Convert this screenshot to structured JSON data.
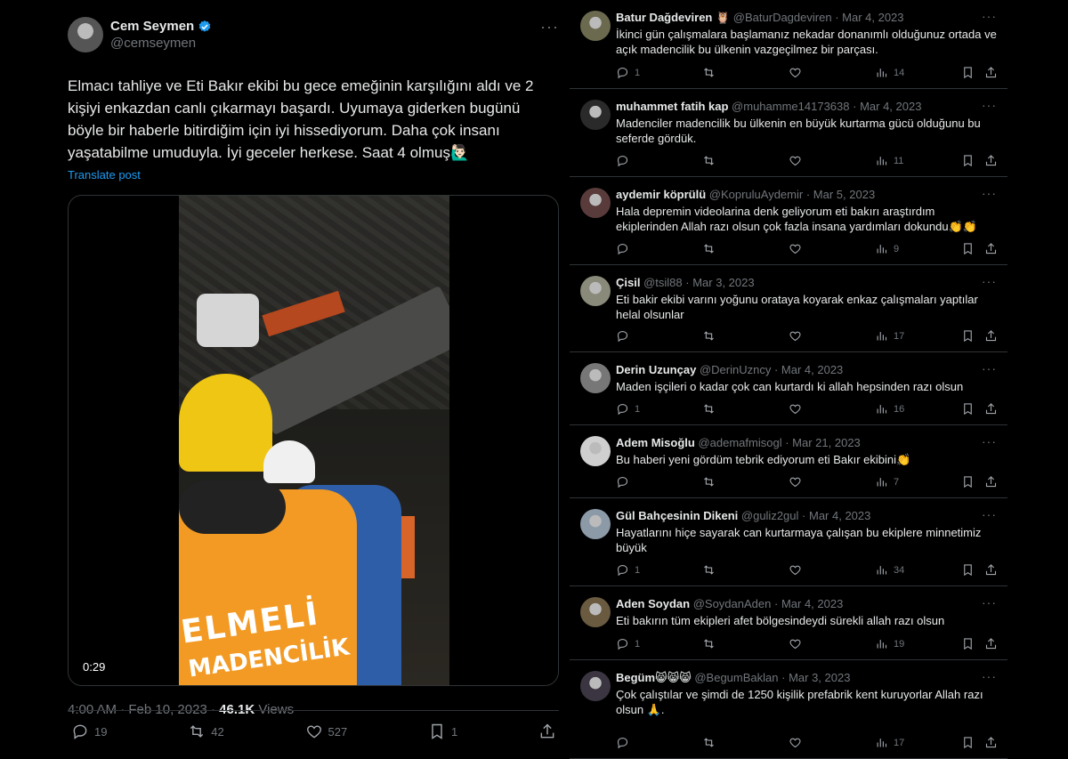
{
  "post": {
    "author_name": "Cem Seymen",
    "author_handle": "@cemseymen",
    "more": "···",
    "text": "Elmacı tahliye ve Eti Bakır ekibi bu gece emeğinin karşılığını aldı ve 2 kişiyi enkazdan canlı çıkarmayı başardı. Uyumaya giderken bugünü böyle bir haberle bitirdiğim için iyi hissediyorum. Daha çok insanı yaşatabilme umuduyla. İyi geceler herkese. Saat 4 olmuş🙋🏻‍♂️",
    "translate_label": "Translate post",
    "video": {
      "duration": "0:29",
      "overlay_line1": "ELMELİ",
      "overlay_line2": "MADENCİLİK"
    },
    "time": "4:00 AM",
    "dot": " · ",
    "date": "Feb 10, 2023",
    "views_count": "46.1K",
    "views_label": " Views",
    "actions": {
      "replies": "19",
      "reposts": "42",
      "likes": "527",
      "bookmarks": "1"
    },
    "colors": {
      "accent": "#1d9bf0",
      "muted": "#71767b",
      "border": "#2f3336"
    }
  },
  "replies": [
    {
      "name": "Batur Dağdeviren 🦉",
      "handle": "@BaturDagdeviren",
      "date": "Mar 4, 2023",
      "text": "İkinci gün çalışmalara başlamanız nekadar donanımlı olduğunuz ortada ve açık madencilik bu ülkenin vazgeçilmez bir parçası.",
      "replies": "1",
      "views": "14"
    },
    {
      "name": "muhammet fatih kap",
      "handle": "@muhamme14173638",
      "date": "Mar 4, 2023",
      "text": "Madenciler madencilik bu ülkenin en büyük kurtarma gücü olduğunu bu seferde gördük.",
      "replies": "",
      "views": "11"
    },
    {
      "name": "aydemir köprülü",
      "handle": "@KopruluAydemir",
      "date": "Mar 5, 2023",
      "text": "Hala depremin videolarina denk geliyorum eti bakırı araştırdım ekiplerinden Allah razı olsun çok fazla insana yardımları dokundu👏👏",
      "replies": "",
      "views": "9"
    },
    {
      "name": "Çisil",
      "handle": "@tsil88",
      "date": "Mar 3, 2023",
      "text": "Eti bakir ekibi varını yoğunu orataya koyarak enkaz çalışmaları yaptılar helal olsunlar",
      "replies": "",
      "views": "17"
    },
    {
      "name": "Derin Uzunçay",
      "handle": "@DerinUzncy",
      "date": "Mar 4, 2023",
      "text": "Maden işçileri o kadar çok can kurtardı ki allah hepsinden razı olsun",
      "replies": "1",
      "views": "16"
    },
    {
      "name": "Adem Misoğlu",
      "handle": "@ademafmisogl",
      "date": "Mar 21, 2023",
      "text": "Bu haberi yeni gördüm tebrik ediyorum eti Bakır ekibini👏",
      "replies": "",
      "views": "7"
    },
    {
      "name": "Gül Bahçesinin Dikeni",
      "handle": "@guliz2gul",
      "date": "Mar 4, 2023",
      "text": "Hayatlarını hiçe sayarak can kurtarmaya çalışan bu ekiplere minnetimiz büyük",
      "replies": "1",
      "views": "34"
    },
    {
      "name": "Aden Soydan",
      "handle": "@SoydanAden",
      "date": "Mar 4, 2023",
      "text": "Eti bakırın tüm ekipleri afet bölgesindeydi sürekli allah razı olsun",
      "replies": "1",
      "views": "19"
    },
    {
      "name": "Begüm😸😸😸",
      "handle": "@BegumBaklan",
      "date": "Mar 3, 2023",
      "text": "Çok çalıştılar ve şimdi de 1250 kişilik prefabrik kent kuruyorlar Allah razı olsun 🙏.",
      "replies": "",
      "views": "17"
    }
  ]
}
